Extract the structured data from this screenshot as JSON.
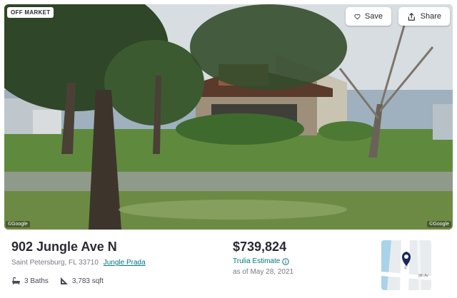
{
  "photo": {
    "badge": "OFF MARKET",
    "credit_left": "©Google",
    "credit_right": "©Google"
  },
  "actions": {
    "save_label": "Save",
    "share_label": "Share",
    "save_icon": "heart-icon",
    "share_icon": "share-icon"
  },
  "listing": {
    "address": "902 Jungle Ave N",
    "city_line": "Saint Petersburg, FL 33710",
    "neighborhood": "Jungle Prada",
    "baths": "3 Baths",
    "sqft": "3,783 sqft",
    "baths_icon": "bathtub-icon",
    "sqft_icon": "ruler-triangle-icon"
  },
  "pricing": {
    "price": "$739,824",
    "estimate_label": "Trulia Estimate",
    "estimate_icon": "info-icon",
    "as_of": "as of May 28, 2021"
  },
  "map": {
    "street_label": "Park St N",
    "cross_label": "9th Av",
    "pin_icon": "map-pin-icon"
  },
  "colors": {
    "accent": "#007882",
    "text": "#2a2a33",
    "muted": "#7a7a85"
  }
}
